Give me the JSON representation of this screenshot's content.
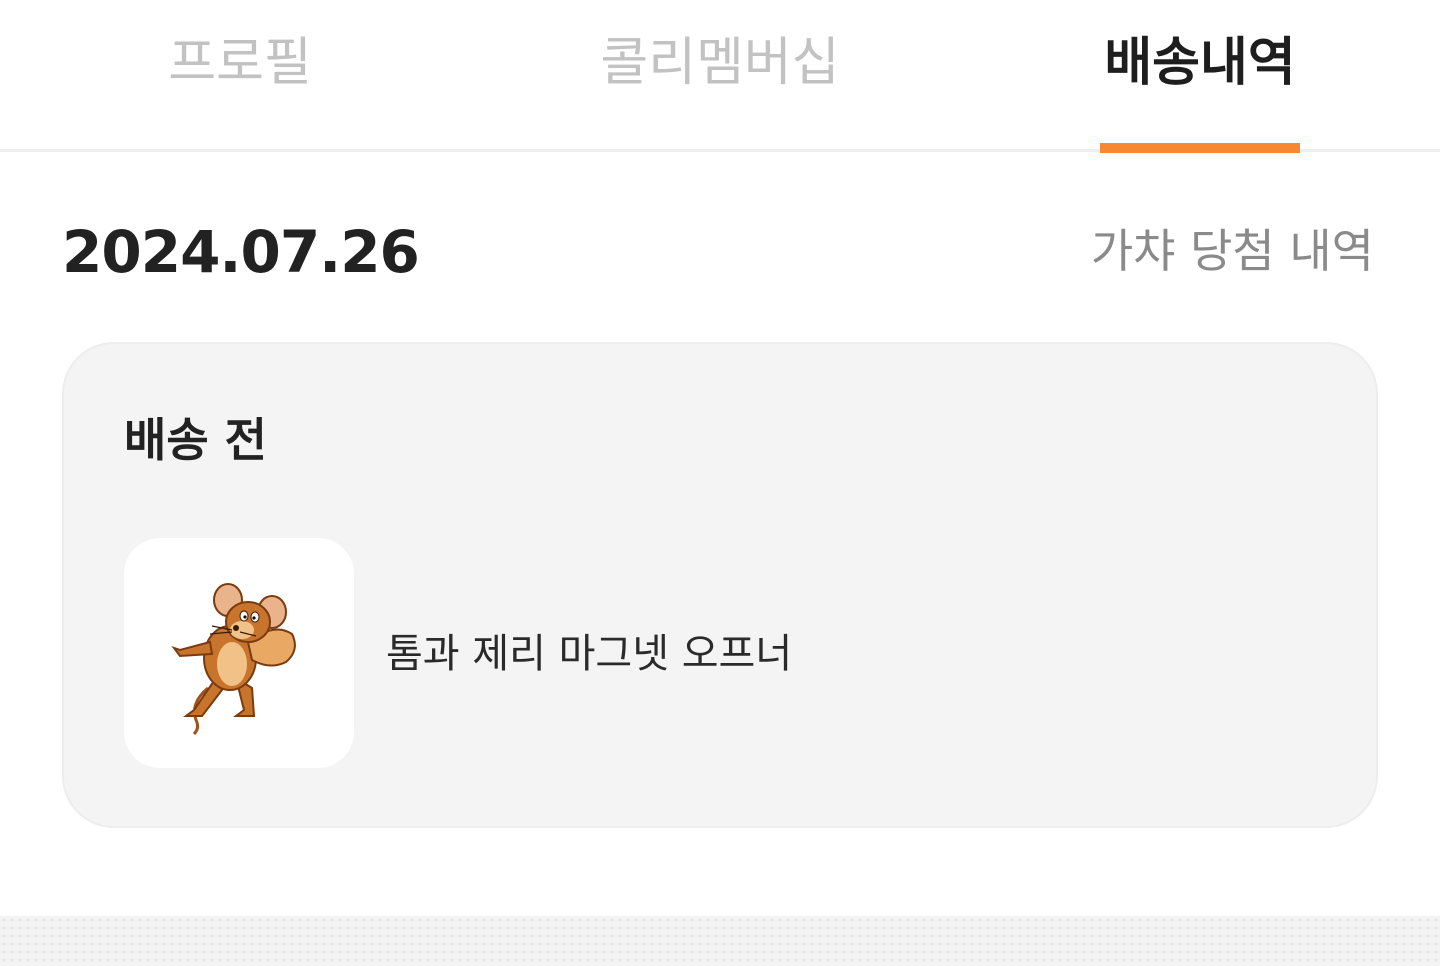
{
  "tabs": [
    {
      "label": "프로필",
      "active": false
    },
    {
      "label": "콜리멤버십",
      "active": false
    },
    {
      "label": "배송내역",
      "active": true
    }
  ],
  "accent_color": "#f7882f",
  "history": {
    "date": "2024.07.26",
    "gacha_link": "가챠 당첨 내역"
  },
  "order": {
    "status": "배송 전",
    "product_name": "톰과 제리 마그넷 오프너",
    "product_image": "jerry-mouse-magnet-image"
  }
}
